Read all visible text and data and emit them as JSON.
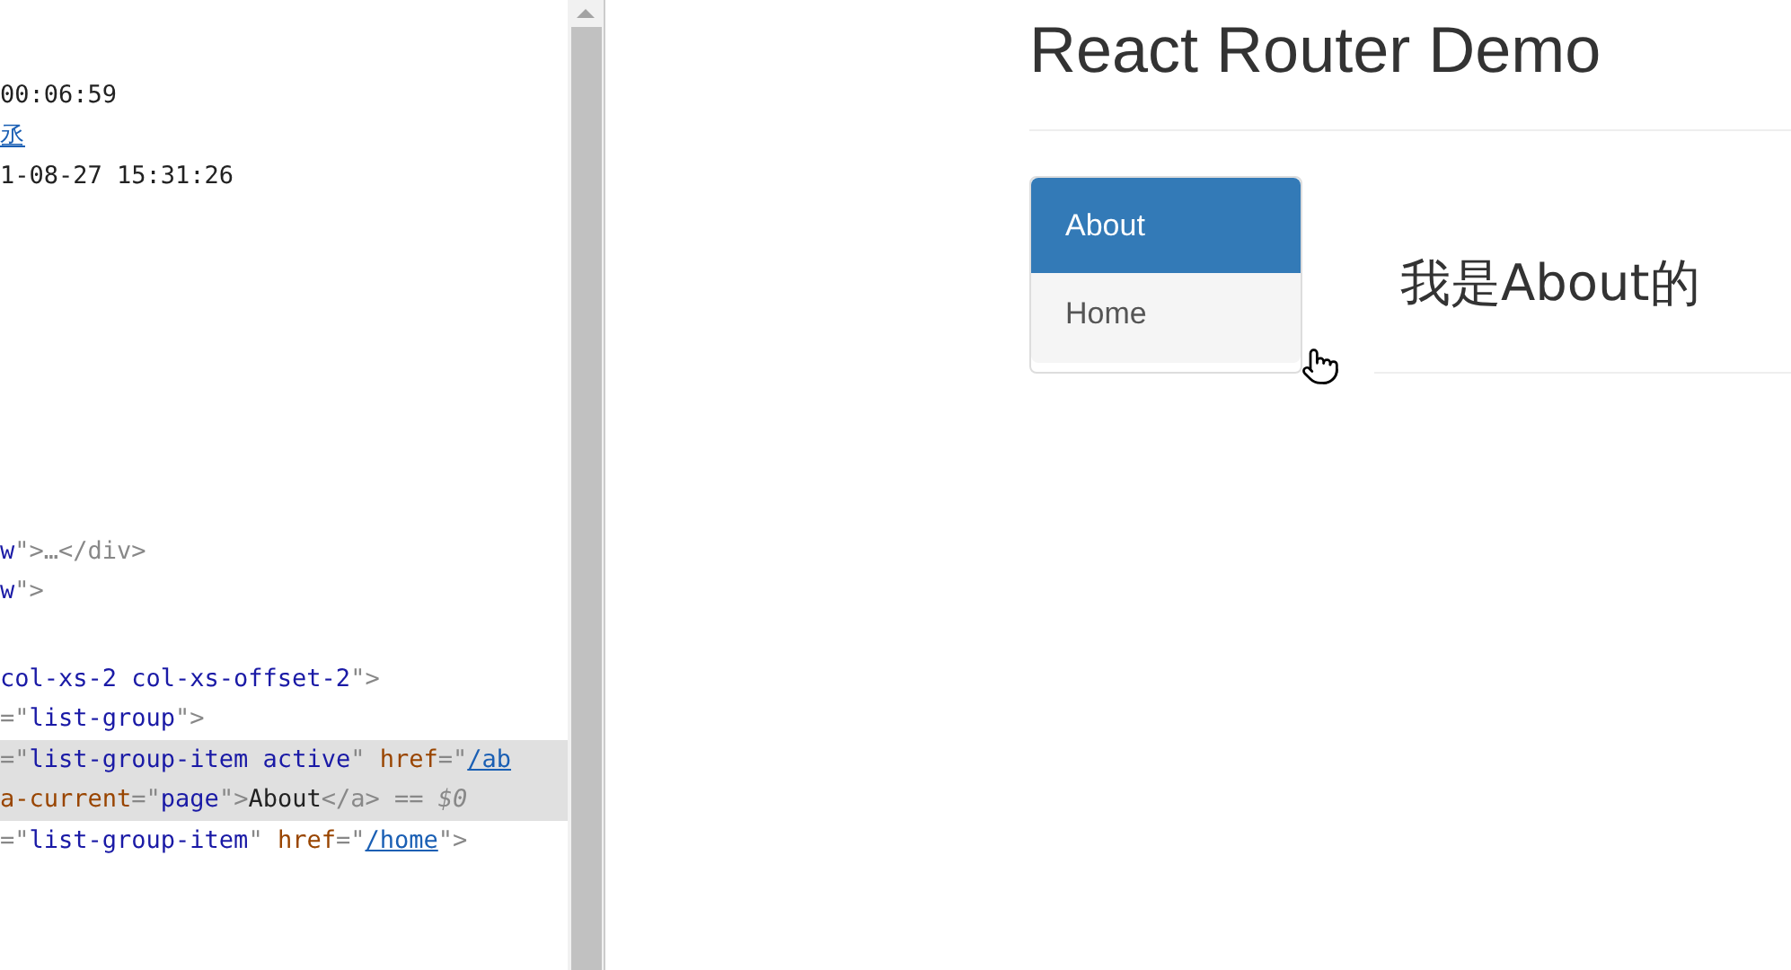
{
  "devtools": {
    "blocks": [
      [
        {
          "selected": false,
          "tokens": [
            {
              "kind": "text",
              "text": "00:06:59"
            }
          ]
        },
        {
          "selected": false,
          "tokens": [
            {
              "kind": "link",
              "text": "丞"
            }
          ]
        },
        {
          "selected": false,
          "tokens": [
            {
              "kind": "text",
              "text": "1-08-27 15:31:26"
            }
          ]
        }
      ],
      [
        {
          "selected": false,
          "tokens": [
            {
              "kind": "value",
              "text": "w"
            },
            {
              "kind": "punct",
              "text": "\">…</div>"
            }
          ]
        },
        {
          "selected": false,
          "tokens": [
            {
              "kind": "value",
              "text": "w"
            },
            {
              "kind": "punct",
              "text": "\">"
            }
          ]
        }
      ],
      [
        {
          "selected": false,
          "tokens": [
            {
              "kind": "value",
              "text": "col-xs-2 col-xs-offset-2"
            },
            {
              "kind": "punct",
              "text": "\">"
            }
          ]
        },
        {
          "selected": false,
          "tokens": [
            {
              "kind": "punct",
              "text": "=\""
            },
            {
              "kind": "value",
              "text": "list-group"
            },
            {
              "kind": "punct",
              "text": "\">"
            }
          ]
        },
        {
          "selected": true,
          "tokens": [
            {
              "kind": "punct",
              "text": "=\""
            },
            {
              "kind": "value",
              "text": "list-group-item active"
            },
            {
              "kind": "punct",
              "text": "\" "
            },
            {
              "kind": "attr",
              "text": "href"
            },
            {
              "kind": "punct",
              "text": "=\""
            },
            {
              "kind": "link",
              "text": "/ab"
            }
          ]
        },
        {
          "selected": true,
          "tokens": [
            {
              "kind": "attr",
              "text": "a-current"
            },
            {
              "kind": "punct",
              "text": "=\""
            },
            {
              "kind": "value",
              "text": "page"
            },
            {
              "kind": "punct",
              "text": "\">"
            },
            {
              "kind": "text",
              "text": "About"
            },
            {
              "kind": "punct",
              "text": "</a>"
            },
            {
              "kind": "comment",
              "text": " == $0"
            }
          ]
        },
        {
          "selected": false,
          "tokens": [
            {
              "kind": "punct",
              "text": "=\""
            },
            {
              "kind": "value",
              "text": "list-group-item"
            },
            {
              "kind": "punct",
              "text": "\" "
            },
            {
              "kind": "attr",
              "text": "href"
            },
            {
              "kind": "punct",
              "text": "=\""
            },
            {
              "kind": "link",
              "text": "/home"
            },
            {
              "kind": "punct",
              "text": "\">"
            }
          ]
        }
      ]
    ]
  },
  "page": {
    "title": "React Router Demo",
    "nav": [
      {
        "label": "About",
        "selected": true
      },
      {
        "label": "Home",
        "selected": false
      }
    ],
    "content": "我是About的"
  }
}
